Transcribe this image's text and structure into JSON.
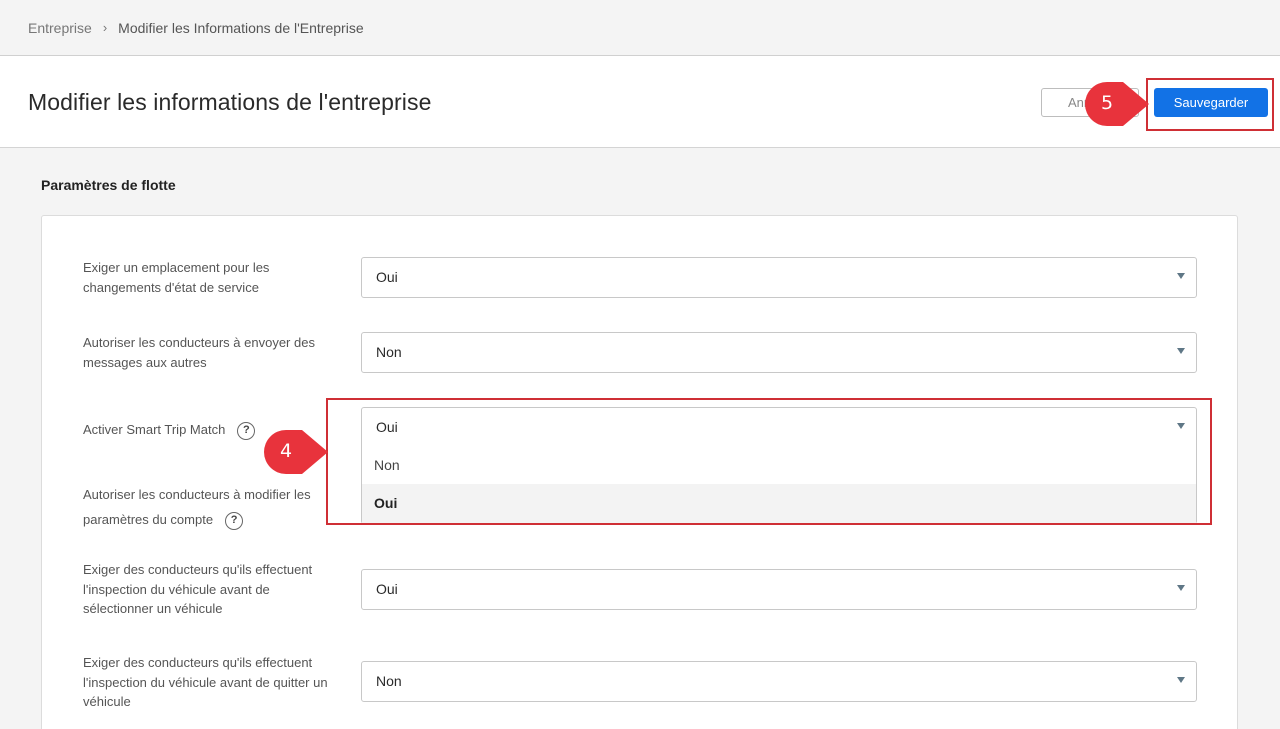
{
  "breadcrumb": {
    "parent": "Entreprise",
    "separator": "›",
    "current": "Modifier les Informations de l'Entreprise"
  },
  "header": {
    "title": "Modifier les informations de l'entreprise",
    "cancel_label": "Annuler",
    "save_label": "Sauvegarder"
  },
  "section": {
    "title": "Paramètres de flotte"
  },
  "settings": [
    {
      "label_line1": "Exiger un emplacement pour les",
      "label_line2": "changements d'état de service",
      "value": "Oui"
    },
    {
      "label_line1": "Autoriser les conducteurs à envoyer des",
      "label_line2": "messages aux autres",
      "value": "Non"
    },
    {
      "label": "Activer Smart Trip Match",
      "value": "Oui",
      "help_icon": "question-circle-icon"
    },
    {
      "label_line1": "Autoriser les conducteurs à modifier les",
      "label_line2": "paramètres du compte",
      "help_icon": "question-circle-icon"
    },
    {
      "label_line1": "Exiger des conducteurs qu'ils effectuent",
      "label_line2": "l'inspection du véhicule avant de",
      "label_line3": "sélectionner un véhicule",
      "value": "Oui"
    },
    {
      "label_line1": "Exiger des conducteurs qu'ils effectuent",
      "label_line2": "l'inspection du véhicule avant de quitter un",
      "label_line3": "véhicule",
      "value": "Non"
    }
  ],
  "dropdown": {
    "options": [
      "Non",
      "Oui"
    ],
    "highlighted": "Oui"
  },
  "callouts": {
    "step4": "4",
    "step5": "5",
    "color": "#e8333c"
  },
  "colors": {
    "primary": "#1272e6",
    "highlight_border": "#cf2f35"
  }
}
